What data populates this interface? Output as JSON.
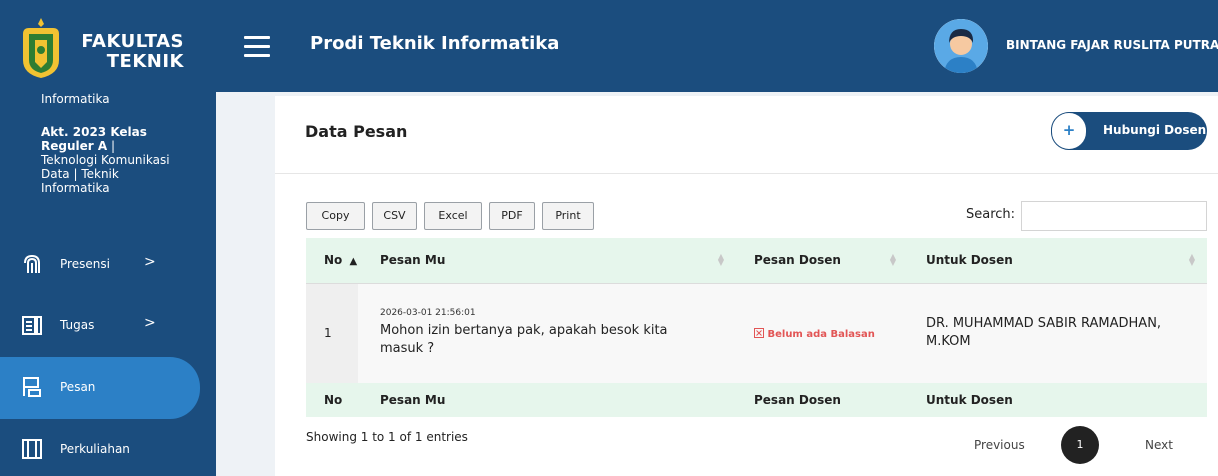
{
  "header": {
    "brand_line1": "FAKULTAS",
    "brand_line2": "TEKNIK",
    "app_title": "Prodi Teknik Informatika",
    "username": "BINTANG FAJAR RUSLITA PUTRA"
  },
  "sidebar": {
    "info_line1": "Informatika",
    "info_bold": "Akt. 2023 Kelas Reguler A",
    "info_rest": " | Teknologi Komunikasi Data | Teknik Informatika",
    "items": [
      {
        "label": "Presensi",
        "chevron": ">"
      },
      {
        "label": "Tugas",
        "chevron": ">"
      },
      {
        "label": "Pesan"
      },
      {
        "label": "Perkuliahan"
      }
    ]
  },
  "main": {
    "title": "Data Pesan",
    "contact_button": "Hubungi Dosen",
    "contact_icon": "+",
    "exports": [
      "Copy",
      "CSV",
      "Excel",
      "PDF",
      "Print"
    ],
    "search_label": "Search:",
    "search_value": "",
    "table": {
      "headers": [
        "No",
        "Pesan Mu",
        "Pesan Dosen",
        "Untuk Dosen"
      ],
      "sort_indicator": "▲",
      "rows": [
        {
          "no": "1",
          "timestamp": "2026-03-01 21:56:01",
          "message": "Mohon izin bertanya pak, apakah besok kita masuk ?",
          "reply": "Belum ada Balasan",
          "lecturer": "DR. MUHAMMAD SABIR RAMADHAN, M.KOM"
        }
      ],
      "footers": [
        "No",
        "Pesan Mu",
        "Pesan Dosen",
        "Untuk Dosen"
      ]
    },
    "info": "Showing 1 to 1 of 1 entries",
    "pagination": {
      "previous": "Previous",
      "current": "1",
      "next": "Next"
    }
  },
  "colors": {
    "primary": "#1b4d7e",
    "active": "#2c80c6",
    "header_row": "#e6f6ec",
    "danger": "#e25555"
  }
}
